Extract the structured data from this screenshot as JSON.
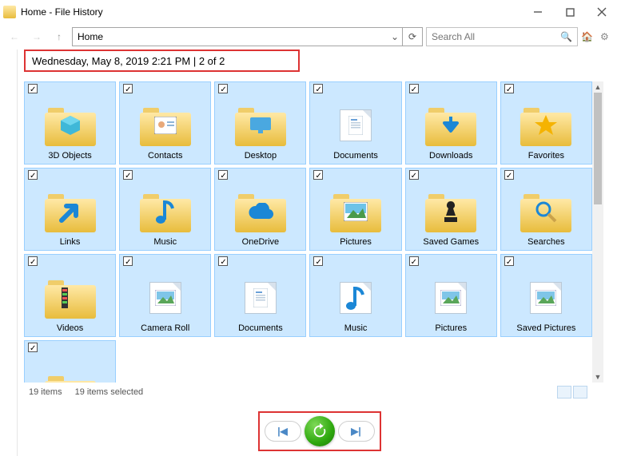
{
  "window": {
    "title": "Home - File History"
  },
  "toolbar": {
    "address": "Home",
    "search_placeholder": "Search All"
  },
  "header": {
    "timestamp_line": "Wednesday, May 8, 2019 2:21 PM   |   2 of 2"
  },
  "items": [
    {
      "label": "3D Objects",
      "kind": "folder",
      "badge": "cube"
    },
    {
      "label": "Contacts",
      "kind": "folder",
      "badge": "contact"
    },
    {
      "label": "Desktop",
      "kind": "folder",
      "badge": "desktop"
    },
    {
      "label": "Documents",
      "kind": "file",
      "badge": "doc"
    },
    {
      "label": "Downloads",
      "kind": "folder",
      "badge": "down"
    },
    {
      "label": "Favorites",
      "kind": "folder",
      "badge": "star"
    },
    {
      "label": "Links",
      "kind": "folder",
      "badge": "link"
    },
    {
      "label": "Music",
      "kind": "folder",
      "badge": "note"
    },
    {
      "label": "OneDrive",
      "kind": "folder",
      "badge": "cloud"
    },
    {
      "label": "Pictures",
      "kind": "folder",
      "badge": "photo"
    },
    {
      "label": "Saved Games",
      "kind": "folder",
      "badge": "chess"
    },
    {
      "label": "Searches",
      "kind": "folder",
      "badge": "mag"
    },
    {
      "label": "Videos",
      "kind": "folder",
      "badge": "film"
    },
    {
      "label": "Camera Roll",
      "kind": "file",
      "badge": "photofile"
    },
    {
      "label": "Documents",
      "kind": "file",
      "badge": "doc"
    },
    {
      "label": "Music",
      "kind": "file",
      "badge": "note"
    },
    {
      "label": "Pictures",
      "kind": "file",
      "badge": "photofile"
    },
    {
      "label": "Saved Pictures",
      "kind": "file",
      "badge": "photofile"
    },
    {
      "label": "",
      "kind": "folder",
      "badge": "film"
    }
  ],
  "status": {
    "count": "19 items",
    "selected": "19 items selected"
  },
  "controls": {
    "prev_glyph": "|◀",
    "next_glyph": "▶|"
  }
}
